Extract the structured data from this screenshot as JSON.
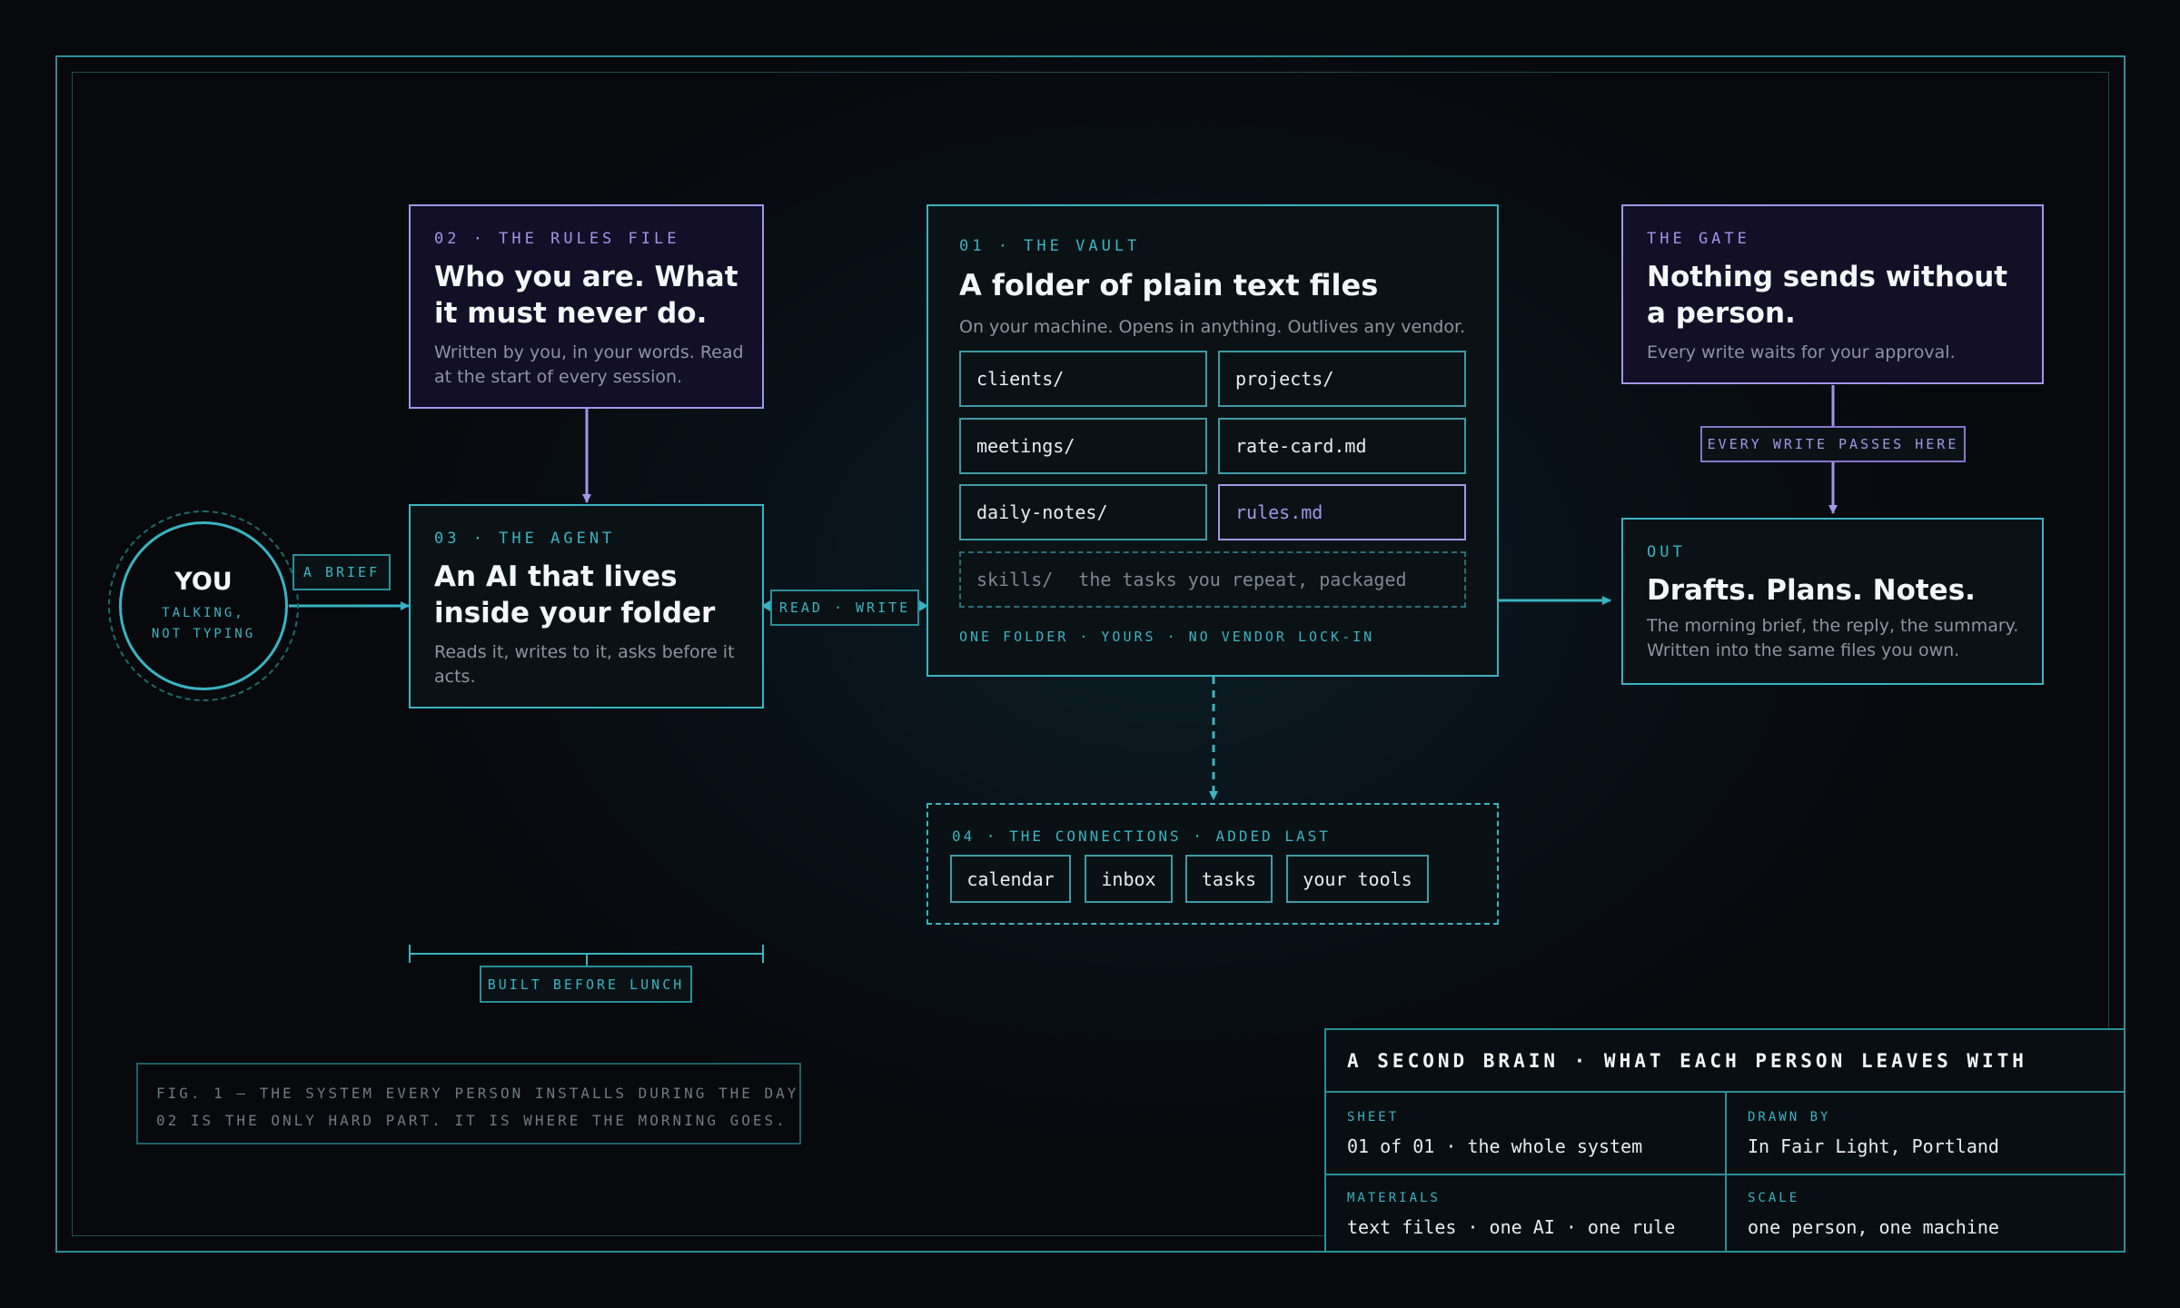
{
  "you": {
    "name": "YOU",
    "sub_line1": "TALKING,",
    "sub_line2": "NOT TYPING"
  },
  "labels": {
    "brief": "A BRIEF",
    "read_write": "READ · WRITE",
    "every_write": "EVERY WRITE PASSES HERE",
    "built_before_lunch": "BUILT BEFORE LUNCH"
  },
  "rules_file": {
    "eyebrow": "02 · THE RULES FILE",
    "title": "Who you are. What it must never do.",
    "desc": "Written by you, in your words. Read at the start of every session."
  },
  "agent": {
    "eyebrow": "03 · THE AGENT",
    "title": "An AI that lives inside your folder",
    "desc": "Reads it, writes to it, asks before it acts."
  },
  "vault": {
    "eyebrow": "01 · THE VAULT",
    "title": "A folder of plain text files",
    "desc": "On your machine. Opens in anything. Outlives any vendor.",
    "files": [
      "clients/",
      "projects/",
      "meetings/",
      "rate-card.md",
      "daily-notes/",
      "rules.md"
    ],
    "skills": {
      "name": "skills/",
      "hint": "the tasks you repeat, packaged"
    },
    "footer": "ONE FOLDER · YOURS · NO VENDOR LOCK-IN"
  },
  "gate": {
    "eyebrow": "THE GATE",
    "title": "Nothing sends without a person.",
    "desc": "Every write waits for your approval."
  },
  "out": {
    "eyebrow": "OUT",
    "title": "Drafts. Plans. Notes.",
    "desc": "The morning brief, the reply, the summary. Written into the same files you own."
  },
  "connections": {
    "eyebrow": "04 · THE CONNECTIONS · ADDED LAST",
    "items": [
      "calendar",
      "inbox",
      "tasks",
      "your tools"
    ]
  },
  "caption": {
    "line1": "FIG. 1 — THE SYSTEM EVERY PERSON INSTALLS DURING THE DAY",
    "line2": "02 IS THE ONLY HARD PART. IT IS WHERE THE MORNING GOES."
  },
  "title_block": {
    "heading": "A SECOND BRAIN · WHAT EACH PERSON LEAVES WITH",
    "sheet_label": "SHEET",
    "sheet_value": "01 of 01 · the whole system",
    "drawn_label": "DRAWN BY",
    "drawn_value": "In Fair Light, Portland",
    "materials_label": "MATERIALS",
    "materials_value": "text files · one AI · one rule",
    "scale_label": "SCALE",
    "scale_value": "one person, one machine"
  },
  "colors": {
    "teal": "#3ab3c2",
    "violet": "#a395e6",
    "background": "#07090c"
  }
}
